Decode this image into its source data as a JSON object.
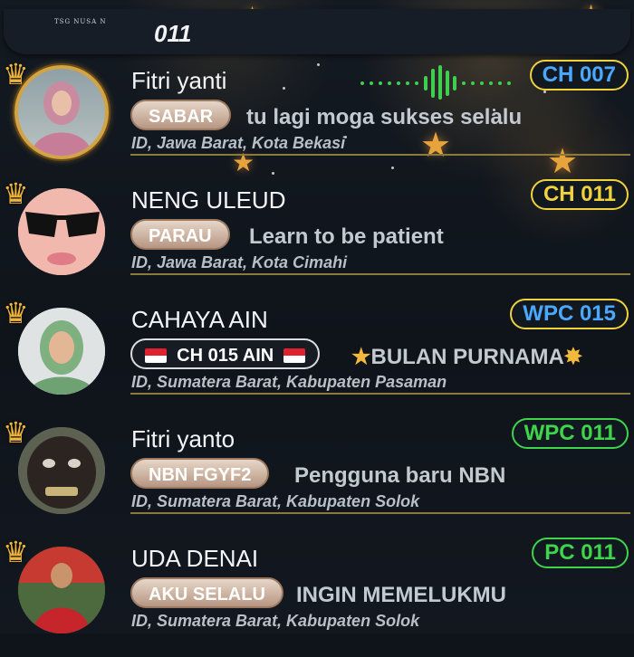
{
  "header": {
    "channel": "011",
    "logo_text": "TSG NUSA N"
  },
  "colors": {
    "crown": "#f0b43c",
    "location_line": "#8c7a3d",
    "wave": "#3ecf4e"
  },
  "users": [
    {
      "name": "Fitri yanti",
      "pill": "SABAR",
      "status": "tu lagi moga  sukses selalu",
      "location": "ID, Jawa Barat, Kota Bekasi",
      "badge": "CH 007",
      "badge_color": "#4aa8ff",
      "pill_style": "light",
      "speaking": true,
      "icons": [
        "crown-icon",
        "avatar-frame"
      ]
    },
    {
      "name": "NENG ULEUD",
      "pill": "PARAU",
      "status": "Learn to be patient",
      "location": "ID, Jawa Barat, Kota Cimahi",
      "badge": "CH 011",
      "badge_color": "#f0d23c",
      "pill_style": "light",
      "icons": [
        "crown-icon"
      ]
    },
    {
      "name": "CAHAYA AIN",
      "pill": "CH 015 AIN",
      "status": "BULAN PURNAMA",
      "location": "ID, Sumatera Barat, Kabupaten Pasaman",
      "badge": "WPC 015",
      "badge_color": "#4aa8ff",
      "pill_style": "dark",
      "icons": [
        "crown-icon",
        "indonesia-flag-icon",
        "star-icon"
      ]
    },
    {
      "name": "Fitri yanto",
      "pill": "NBN  FGYF2",
      "status": "Pengguna baru NBN",
      "location": "ID, Sumatera Barat, Kabupaten Solok",
      "badge": "WPC 011",
      "badge_color": "#3ed44c",
      "pill_style": "light",
      "icons": [
        "crown-icon"
      ]
    },
    {
      "name": "UDA DENAI",
      "pill": "AKU SELALU",
      "status": "INGIN MEMELUKMU",
      "location": "ID, Sumatera Barat, Kabupaten Solok",
      "badge": "PC 011",
      "badge_color": "#3ed44c",
      "pill_style": "light",
      "icons": [
        "crown-icon"
      ]
    }
  ]
}
